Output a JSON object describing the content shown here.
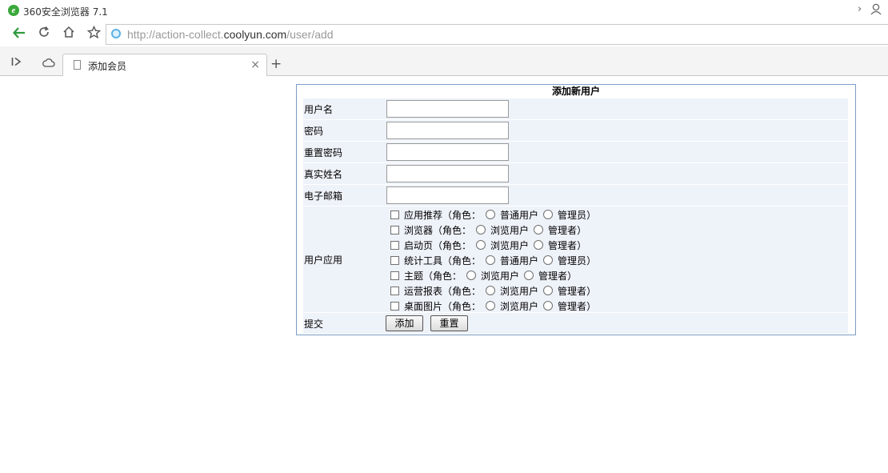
{
  "browser": {
    "title": "360安全浏览器 7.1",
    "url_prefix": "http://action-collect.",
    "url_host": "coolyun.com",
    "url_path": "/user/add",
    "tab_label": "添加会员",
    "tab_close": "×",
    "new_tab": "+",
    "icons": [
      "back-arrow-icon",
      "refresh-icon",
      "home-icon",
      "star-icon",
      "globe-icon",
      "sidebar-toggle-icon",
      "cloud-icon",
      "document-icon"
    ]
  },
  "form": {
    "title": "添加新用户",
    "fields": [
      {
        "label": "用户名",
        "value": ""
      },
      {
        "label": "密码",
        "value": ""
      },
      {
        "label": "重置密码",
        "value": ""
      },
      {
        "label": "真实姓名",
        "value": ""
      },
      {
        "label": "电子邮箱",
        "value": ""
      }
    ],
    "apps_label": "用户应用",
    "apps": [
      {
        "name": "应用推荐",
        "role_prefix": "（角色：",
        "roles": [
          "普通用户",
          "管理员"
        ]
      },
      {
        "name": "浏览器",
        "role_prefix": "（角色：",
        "roles": [
          "浏览用户",
          "管理者"
        ]
      },
      {
        "name": "启动页",
        "role_prefix": "（角色：",
        "roles": [
          "浏览用户",
          "管理者"
        ]
      },
      {
        "name": "统计工具",
        "role_prefix": "（角色：",
        "roles": [
          "普通用户",
          "管理员"
        ]
      },
      {
        "name": "主题",
        "role_prefix": "（角色：",
        "roles": [
          "浏览用户",
          "管理者"
        ]
      },
      {
        "name": "运营报表",
        "role_prefix": "（角色：",
        "roles": [
          "浏览用户",
          "管理者"
        ]
      },
      {
        "name": "桌面图片",
        "role_prefix": "（角色：",
        "roles": [
          "浏览用户",
          "管理者"
        ]
      }
    ],
    "role_suffix": "）",
    "submit_label": "提交",
    "add_button": "添加",
    "reset_button": "重置"
  },
  "colors": {
    "border": "#7a9cc4",
    "row_bg": "#eef2f9",
    "back_arrow": "#2e9a3c"
  }
}
